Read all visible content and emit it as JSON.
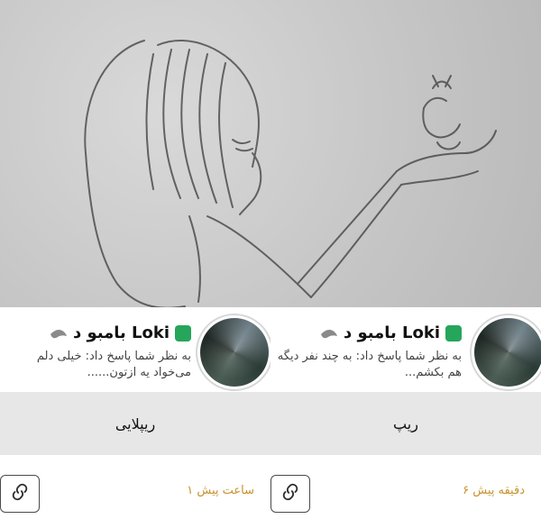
{
  "sketch": {
    "icon_name": "pencil-sketch-illustration"
  },
  "panels": [
    {
      "username": "بامبو د Loki",
      "comment": "به نظر شما پاسخ داد: خیلی دلم می‌خواد یه ازتون......",
      "reply_label": "ریپلایی",
      "time": "۱ ساعت پیش"
    },
    {
      "username": "بامبو د Loki",
      "comment": "به نظر شما پاسخ داد: به چند نفر دیگه هم بکشم...",
      "reply_label": "ریپ",
      "time": "۶ دقیقه پیش"
    }
  ],
  "colors": {
    "time": "#c7922c",
    "reply_bg": "#e7e7e7"
  }
}
